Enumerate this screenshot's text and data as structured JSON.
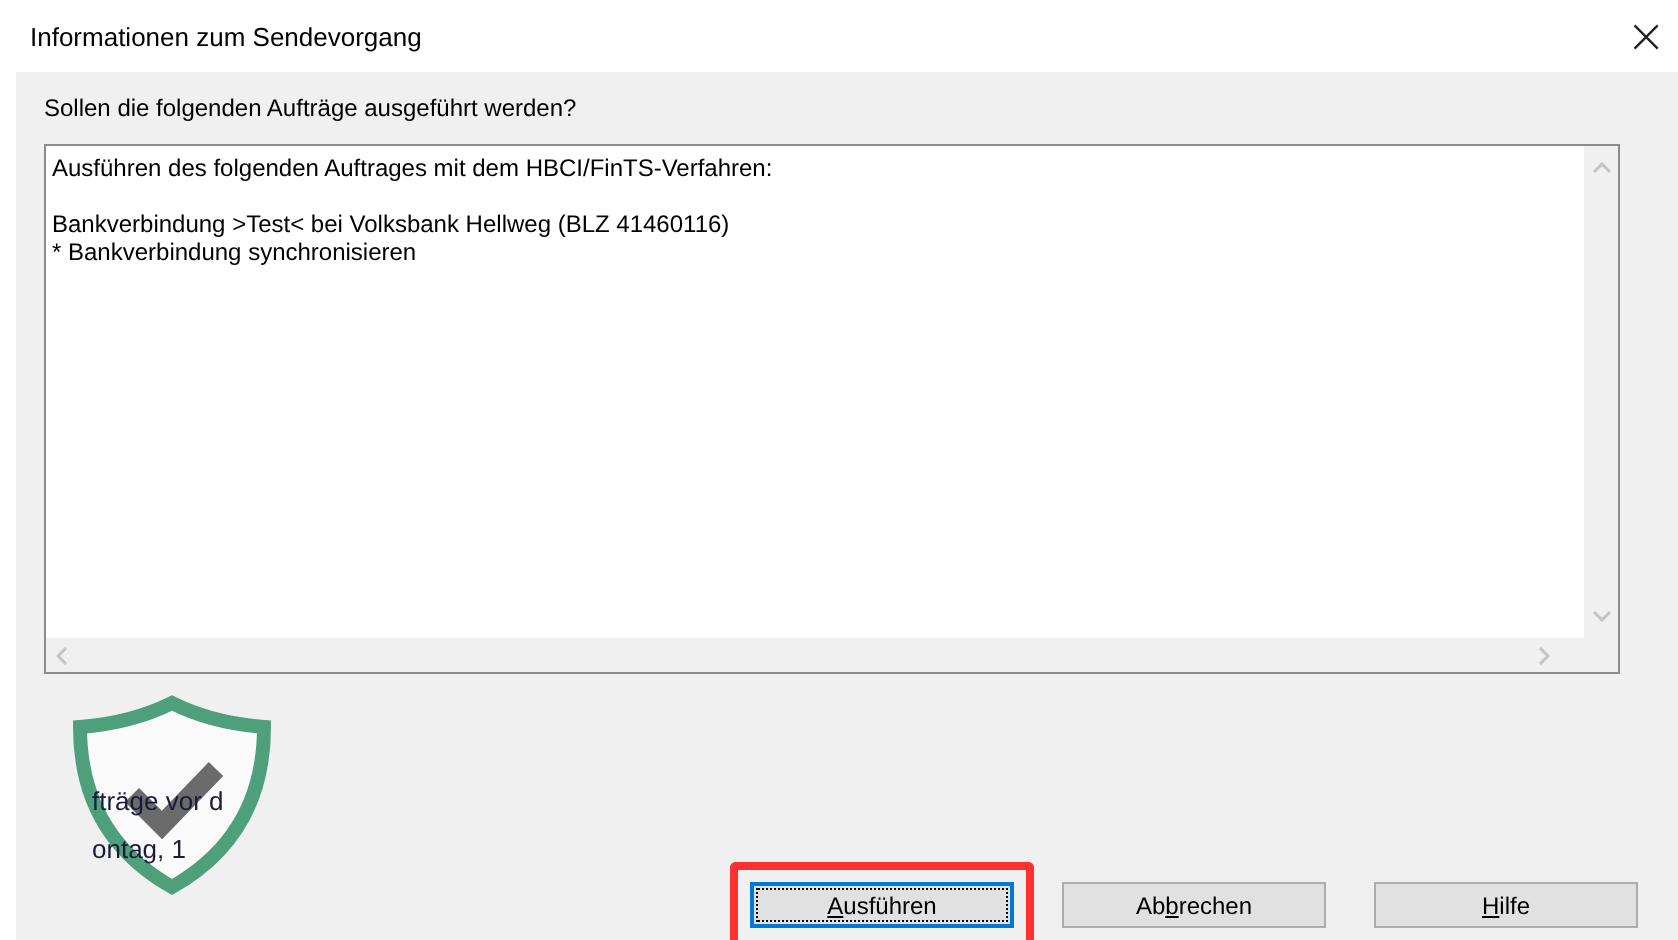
{
  "window": {
    "title": "Informationen zum Sendevorgang",
    "close": "×"
  },
  "prompt": "Sollen die folgenden Aufträge ausgeführt werden?",
  "details": {
    "paragraphs": [
      [
        "Ausführen des folgenden Auftrages mit dem HBCI/FinTS-Verfahren:"
      ],
      [
        "Bankverbindung >Test< bei Volksbank Hellweg (BLZ 41460116)",
        "* Bankverbindung synchronisieren"
      ]
    ]
  },
  "notice": [
    "fträge vor d",
    "ontag, 1"
  ],
  "buttons": [
    {
      "label": {
        "key": "A",
        "rest": "usführen"
      },
      "default": true,
      "highlighted": true
    },
    {
      "label": {
        "lead": "Ab",
        "key": "b",
        "rest": "rechen"
      },
      "default": false,
      "highlighted": false
    },
    {
      "label": {
        "key": "H",
        "rest": "ilfe"
      },
      "default": false,
      "highlighted": false
    }
  ]
}
